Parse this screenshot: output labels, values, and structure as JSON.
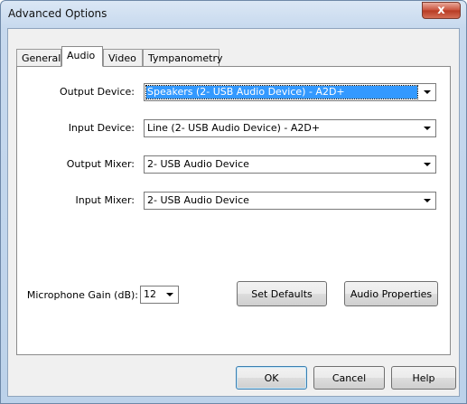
{
  "window": {
    "title": "Advanced Options",
    "close_glyph": "x"
  },
  "tabs": [
    {
      "label": "General"
    },
    {
      "label": "Audio"
    },
    {
      "label": "Video"
    },
    {
      "label": "Tympanometry"
    }
  ],
  "active_tab": "Audio",
  "fields": [
    {
      "label": "Output Device:",
      "value": "Speakers (2- USB Audio Device) - A2D+",
      "selected": true
    },
    {
      "label": "Input Device:",
      "value": "Line (2- USB Audio Device) - A2D+"
    },
    {
      "label": "Output Mixer:",
      "value": "2- USB Audio Device"
    },
    {
      "label": "Input Mixer:",
      "value": "2- USB Audio Device"
    }
  ],
  "gain": {
    "label": "Microphone Gain (dB):",
    "value": "12"
  },
  "buttons": {
    "set_defaults": "Set Defaults",
    "audio_properties": "Audio Properties",
    "ok": "OK",
    "cancel": "Cancel",
    "help": "Help"
  },
  "icons": {
    "dropdown": "chevron-down-icon",
    "close": "close-icon"
  }
}
